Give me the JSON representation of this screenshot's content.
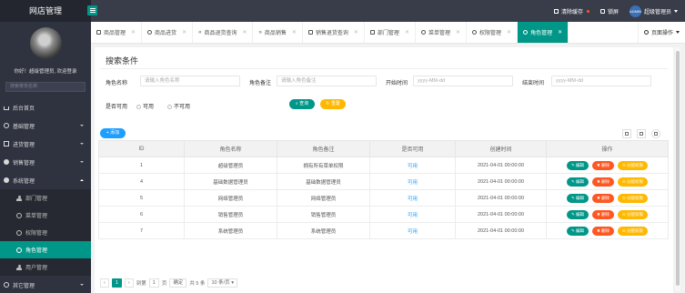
{
  "header": {
    "logo": "网店管理",
    "clear_cache": "清除缓存",
    "lock_screen": "锁屏",
    "avatar_text": "ADMIN",
    "user_name": "超级管理员"
  },
  "sidebar": {
    "welcome": "你好！超级管理员, 欢迎登录",
    "search_placeholder": "搜索菜单名称",
    "items": [
      {
        "label": "后台首页"
      },
      {
        "label": "基础管理"
      },
      {
        "label": "进货管理"
      },
      {
        "label": "销售管理"
      },
      {
        "label": "系统管理"
      },
      {
        "label": "部门管理"
      },
      {
        "label": "菜单管理"
      },
      {
        "label": "权限管理"
      },
      {
        "label": "角色管理"
      },
      {
        "label": "用户管理"
      },
      {
        "label": "其它管理"
      }
    ]
  },
  "tabs": [
    {
      "label": "商品管理"
    },
    {
      "label": "商品进货"
    },
    {
      "label": "商品退货查询"
    },
    {
      "label": "商品销售"
    },
    {
      "label": "销售退货查询"
    },
    {
      "label": "部门管理"
    },
    {
      "label": "菜单管理"
    },
    {
      "label": "权限管理"
    },
    {
      "label": "角色管理"
    }
  ],
  "page_ops": "页面操作",
  "search": {
    "title": "搜索条件",
    "role_name_label": "角色名称",
    "role_name_placeholder": "请输入角色名称",
    "role_remark_label": "角色备注",
    "role_remark_placeholder": "请输入角色备注",
    "start_label": "开始时间",
    "start_placeholder": "yyyy-MM-dd",
    "end_label": "结束时间",
    "end_placeholder": "yyyy-MM-dd",
    "available_label": "是否可用",
    "opt_yes": "可用",
    "opt_no": "不可用",
    "query_btn": "查询",
    "reset_btn": "重置"
  },
  "toolbar": {
    "add_btn": "+ 添加"
  },
  "table": {
    "columns": [
      "ID",
      "角色名称",
      "角色备注",
      "是否可用",
      "创建时间",
      "操作"
    ],
    "rows": [
      {
        "id": "1",
        "name": "超级管理员",
        "remark": "拥有所有菜单权限",
        "available": "可用",
        "created": "2021-04-01 00:00:00"
      },
      {
        "id": "4",
        "name": "基础数据管理员",
        "remark": "基础数据管理员",
        "available": "可用",
        "created": "2021-04-01 00:00:00"
      },
      {
        "id": "5",
        "name": "网络管理员",
        "remark": "网络管理员",
        "available": "可用",
        "created": "2021-04-01 00:00:00"
      },
      {
        "id": "6",
        "name": "销售管理员",
        "remark": "销售管理员",
        "available": "可用",
        "created": "2021-04-01 00:00:00"
      },
      {
        "id": "7",
        "name": "系统管理员",
        "remark": "系统管理员",
        "available": "可用",
        "created": "2021-04-01 00:00:00"
      }
    ],
    "op_edit": "编辑",
    "op_delete": "删除",
    "op_assign": "分配权限"
  },
  "pager": {
    "current": "1",
    "goto": "到第",
    "page_input": "1",
    "page_unit": "页",
    "confirm": "确定",
    "total": "共 5 条",
    "page_size": "10 条/页"
  },
  "colors": {
    "primary": "#009688",
    "warning": "#ffb800",
    "info": "#1e9fff",
    "danger": "#ff5722",
    "sidebar": "#2f3340"
  }
}
